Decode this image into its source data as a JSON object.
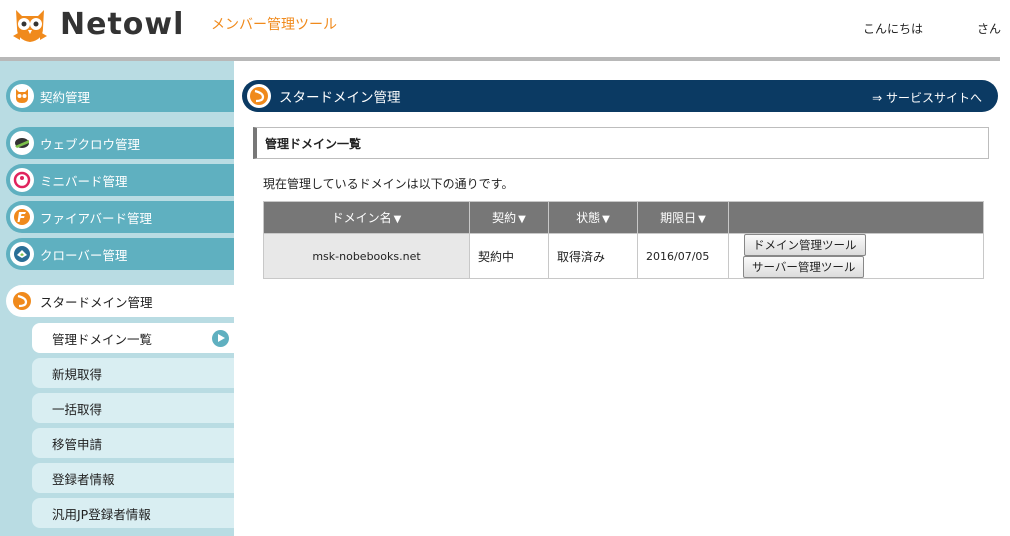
{
  "header": {
    "logo_text": "Netowl",
    "tool_title": "メンバー管理ツール",
    "greeting": "こんにちは",
    "honorific": "さん"
  },
  "sidebar": {
    "items": [
      {
        "label": "契約管理",
        "icon": "owl-icon"
      },
      {
        "label": "ウェブクロウ管理",
        "icon": "crow-icon"
      },
      {
        "label": "ミニバード管理",
        "icon": "minibird-icon"
      },
      {
        "label": "ファイアバード管理",
        "icon": "firebird-icon"
      },
      {
        "label": "クローバー管理",
        "icon": "clover-icon"
      },
      {
        "label": "スタードメイン管理",
        "icon": "stardomain-icon"
      }
    ],
    "sub_items": [
      {
        "label": "管理ドメイン一覧"
      },
      {
        "label": "新規取得"
      },
      {
        "label": "一括取得"
      },
      {
        "label": "移管申請"
      },
      {
        "label": "登録者情報"
      },
      {
        "label": "汎用JP登録者情報"
      }
    ]
  },
  "main": {
    "title": "スタードメイン管理",
    "service_link": "⇒ サービスサイトへ",
    "section_title": "管理ドメイン一覧",
    "description": "現在管理しているドメインは以下の通りです。",
    "table": {
      "columns": [
        "ドメイン名",
        "契約",
        "状態",
        "期限日",
        ""
      ],
      "rows": [
        {
          "domain": "msk-nobebooks.net",
          "contract": "契約中",
          "status": "取得済み",
          "expiry": "2016/07/05",
          "btn_domain_tool": "ドメイン管理ツール",
          "btn_server_tool": "サーバー管理ツール"
        }
      ]
    }
  },
  "colors": {
    "accent_orange": "#f08a1c",
    "sidebar_teal": "#5fb0c0",
    "sidebar_bg": "#b9dce3",
    "title_navy": "#0b3a63",
    "table_header": "#777777"
  }
}
